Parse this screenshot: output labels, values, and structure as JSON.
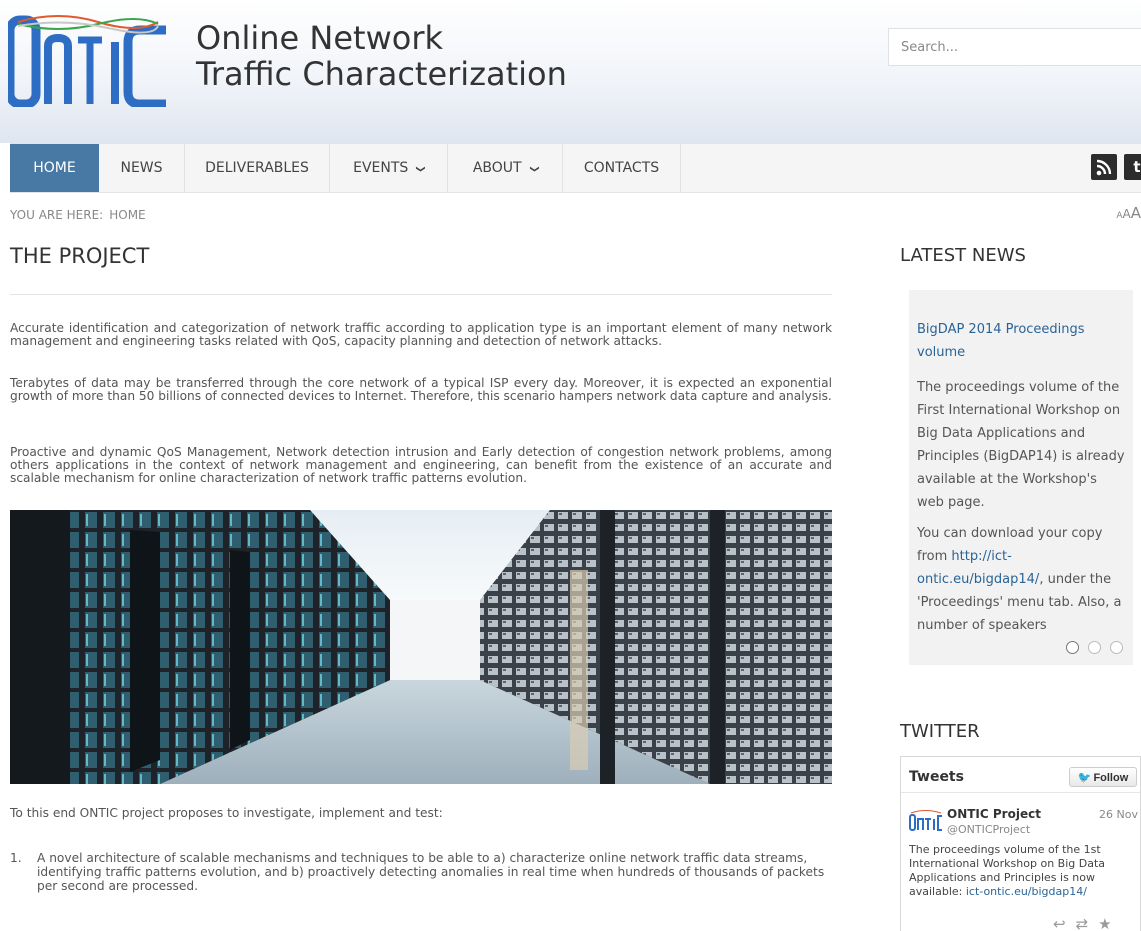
{
  "site": {
    "title_line1": "Online Network",
    "title_line2": "Traffic Characterization",
    "logo_text": "ONTIC"
  },
  "search": {
    "placeholder": "Search..."
  },
  "nav": {
    "items": [
      {
        "label": "HOME",
        "active": true
      },
      {
        "label": "NEWS"
      },
      {
        "label": "DELIVERABLES"
      },
      {
        "label": "EVENTS",
        "dropdown": true
      },
      {
        "label": "ABOUT",
        "dropdown": true
      },
      {
        "label": "CONTACTS"
      }
    ],
    "caret": "❯",
    "social": {
      "rss": "rss-icon",
      "twitter": "twitter-icon"
    }
  },
  "breadcrumb": {
    "prefix": "YOU ARE HERE:",
    "current": "HOME"
  },
  "fontsize": {
    "small": "A",
    "medium": "A",
    "large": "A"
  },
  "main": {
    "title": "THE PROJECT",
    "paragraphs": [
      "Accurate identification and categorization of network traffic according to application type is an important element of many network management and engineering tasks related with QoS, capacity planning and detection of network attacks.",
      "Terabytes of data may be transferred through the core network of a typical ISP every day. Moreover, it is expected an exponential growth of more than 50 billions of connected devices to Internet. Therefore, this scenario hampers network data capture and analysis.",
      "Proactive and dynamic QoS Management, Network detection intrusion and Early detection of congestion network problems, among others applications in the context of network management and engineering, can benefit from the existence of an accurate and scalable mechanism for online characterization of network traffic patterns evolution."
    ],
    "intro": "To this end ONTIC project proposes to investigate, implement and test:",
    "list": [
      {
        "num": "1.",
        "text": "A novel architecture of scalable mechanisms and techniques to be able to a) characterize online network traffic data streams, identifying traffic patterns evolution, and b) proactively detecting anomalies in real time when hundreds of thousands of packets per second are processed."
      }
    ]
  },
  "sidebar": {
    "news_heading": "LATEST NEWS",
    "news_title": "BigDAP 2014 Proceedings volume",
    "news_body1": "The proceedings volume of the First International Workshop on Big Data Applications and Principles (BigDAP14) is already available at the Workshop's web page.",
    "news_body2_pre": "You can download your copy from ",
    "news_link": "http://ict-ontic.eu/bigdap14/",
    "news_body2_post": ", under the 'Proceedings' menu tab. Also, a number of speakers",
    "twitter_heading": "TWITTER",
    "tweets_title": "Tweets",
    "follow_label": "Follow",
    "tweet": {
      "name": "ONTIC Project",
      "handle": "@ONTICProject",
      "date": "26 Nov",
      "text": "The proceedings volume of the 1st International Workshop on Big Data Applications and Principles is now available: ",
      "link": "ict-ontic.eu/bigdap14/"
    }
  },
  "colors": {
    "accent": "#4779a4",
    "link": "#2a6496",
    "logo_blue": "#2d6ec4"
  }
}
